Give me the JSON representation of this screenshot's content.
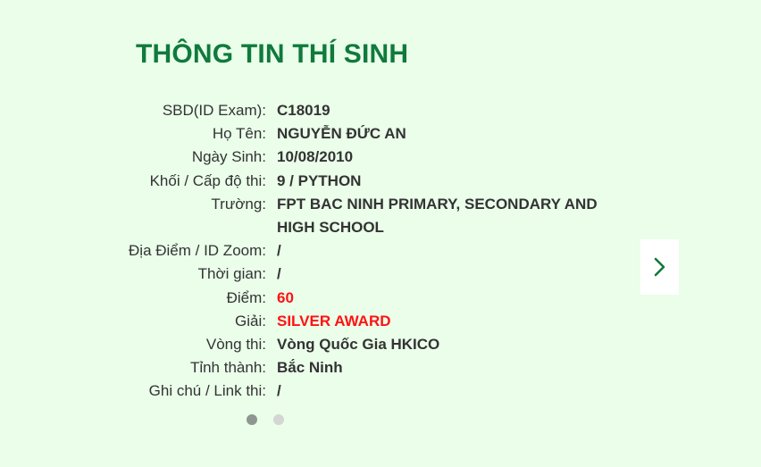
{
  "page": {
    "title": "THÔNG TIN THÍ SINH"
  },
  "fields": [
    {
      "label": "SBD(ID Exam):",
      "value": "C18019",
      "highlight": false
    },
    {
      "label": "Họ Tên:",
      "value": "NGUYỄN ĐỨC AN",
      "highlight": false
    },
    {
      "label": "Ngày Sinh:",
      "value": "10/08/2010",
      "highlight": false
    },
    {
      "label": "Khối / Cấp độ thi:",
      "value": "9 / PYTHON",
      "highlight": false
    },
    {
      "label": "Trường:",
      "value": "FPT BAC NINH PRIMARY, SECONDARY AND HIGH SCHOOL",
      "highlight": false
    },
    {
      "label": "Địa Điểm / ID Zoom:",
      "value": "/",
      "highlight": false
    },
    {
      "label": "Thời gian:",
      "value": "/",
      "highlight": false
    },
    {
      "label": "Điểm:",
      "value": "60",
      "highlight": true
    },
    {
      "label": "Giải:",
      "value": "SILVER AWARD",
      "highlight": true
    },
    {
      "label": "Vòng thi:",
      "value": "Vòng Quốc Gia HKICO",
      "highlight": false
    },
    {
      "label": "Tỉnh thành:",
      "value": "Bắc Ninh",
      "highlight": false
    },
    {
      "label": "Ghi chú / Link thi:",
      "value": "/",
      "highlight": false
    }
  ],
  "carousel": {
    "next_icon": "chevron-right-icon",
    "slide_count": 2,
    "active_slide": 1
  },
  "colors": {
    "background": "#eafeea",
    "title": "#0f7a3c",
    "text": "#333333",
    "highlight": "#ff1212",
    "dot_active": "#8d9690",
    "dot_inactive": "#d3d6d3"
  }
}
